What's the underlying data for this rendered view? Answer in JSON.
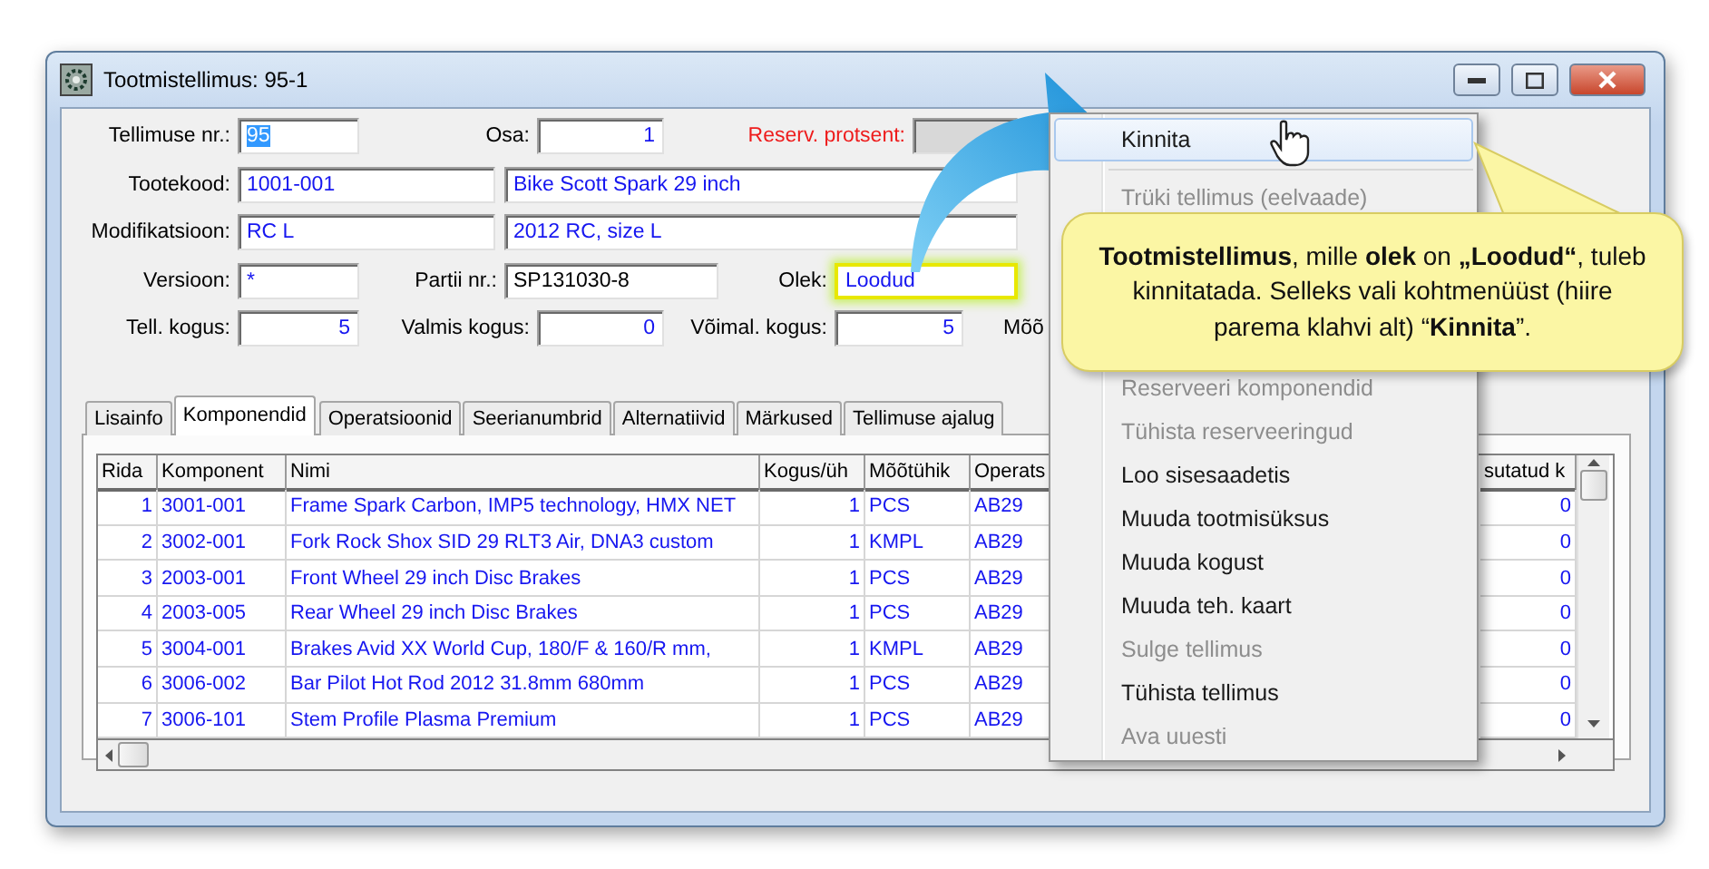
{
  "window": {
    "title": "Tootmistellimus: 95-1"
  },
  "form": {
    "rows": [
      {
        "cells": [
          {
            "kind": "label",
            "text": "Tellimuse nr.:",
            "alert": false
          },
          {
            "kind": "text-field",
            "value": "95",
            "selected": true,
            "disabled": false,
            "highlighted": false
          },
          {
            "kind": "label",
            "text": "Osa:",
            "alert": false
          },
          {
            "kind": "number-field",
            "value": "1",
            "selected": false,
            "disabled": false,
            "highlighted": false
          },
          {
            "kind": "label",
            "text": "Reserv. protsent:",
            "alert": true
          },
          {
            "kind": "text-field",
            "disabled": true,
            "highlighted": false
          }
        ]
      },
      {
        "cells": [
          {
            "kind": "label",
            "text": "Tootekood:",
            "alert": false
          },
          {
            "kind": "text-field",
            "value": "1001-001",
            "selected": false,
            "disabled": false,
            "highlighted": false
          },
          {
            "kind": "text-field",
            "value": "Bike Scott Spark 29 inch",
            "selected": false,
            "disabled": false,
            "highlighted": false
          }
        ]
      },
      {
        "cells": [
          {
            "kind": "label",
            "text": "Modifikatsioon:",
            "alert": false
          },
          {
            "kind": "text-field",
            "value": "RC L",
            "selected": false,
            "disabled": false,
            "highlighted": false
          },
          {
            "kind": "text-field",
            "value": "2012 RC, size L",
            "selected": false,
            "disabled": false,
            "highlighted": false
          }
        ]
      },
      {
        "cells": [
          {
            "kind": "label",
            "text": "Versioon:",
            "alert": false
          },
          {
            "kind": "text-field",
            "value": "*",
            "selected": false,
            "disabled": false,
            "highlighted": false
          },
          {
            "kind": "label",
            "text": "Partii nr.:",
            "alert": false
          },
          {
            "kind": "plain-field",
            "value": "SP131030-8",
            "selected": false,
            "disabled": false,
            "highlighted": false
          },
          {
            "kind": "label",
            "text": "Olek:",
            "alert": false
          },
          {
            "kind": "text-field",
            "value": "Loodud",
            "selected": false,
            "disabled": false,
            "highlighted": true
          }
        ]
      },
      {
        "cells": [
          {
            "kind": "label",
            "text": "Tell. kogus:",
            "alert": false
          },
          {
            "kind": "number-field",
            "value": "5",
            "selected": false,
            "disabled": false,
            "highlighted": false
          },
          {
            "kind": "label",
            "text": "Valmis kogus:",
            "alert": false
          },
          {
            "kind": "number-field",
            "value": "0",
            "selected": false,
            "disabled": false,
            "highlighted": false
          },
          {
            "kind": "label",
            "text": "Võimal. kogus:",
            "alert": false
          },
          {
            "kind": "number-field",
            "value": "5",
            "selected": false,
            "disabled": false,
            "highlighted": false
          },
          {
            "kind": "label",
            "text": "Mõõ",
            "alert": false
          }
        ]
      }
    ]
  },
  "tabs": [
    {
      "label": "Lisainfo",
      "selected": false
    },
    {
      "label": "Komponendid",
      "selected": true
    },
    {
      "label": "Operatsioonid",
      "selected": false
    },
    {
      "label": "Seerianumbrid",
      "selected": false
    },
    {
      "label": "Alternatiivid",
      "selected": false
    },
    {
      "label": "Märkused",
      "selected": false
    },
    {
      "label": "Tellimuse ajalug",
      "selected": false
    }
  ],
  "table": {
    "columns": [
      "Rida",
      "Komponent",
      "Nimi",
      "Kogus/üh",
      "Mõõtühik",
      "Operats",
      "sutatud k"
    ],
    "rows": [
      [
        "1",
        "3001-001",
        "Frame Spark Carbon, IMP5 technology, HMX NET",
        "1",
        "PCS",
        "AB29",
        "0"
      ],
      [
        "2",
        "3002-001",
        "Fork Rock Shox SID 29 RLT3 Air, DNA3 custom",
        "1",
        "KMPL",
        "AB29",
        "0"
      ],
      [
        "3",
        "2003-001",
        "Front Wheel 29 inch Disc Brakes",
        "1",
        "PCS",
        "AB29",
        "0"
      ],
      [
        "4",
        "2003-005",
        "Rear Wheel 29 inch Disc Brakes",
        "1",
        "PCS",
        "AB29",
        "0"
      ],
      [
        "5",
        "3004-001",
        "Brakes Avid XX World Cup, 180/F & 160/R mm,",
        "1",
        "KMPL",
        "AB29",
        "0"
      ],
      [
        "6",
        "3006-002",
        "Bar Pilot Hot Rod 2012 31.8mm 680mm",
        "1",
        "PCS",
        "AB29",
        "0"
      ],
      [
        "7",
        "3006-101",
        "Stem Profile Plasma Premium",
        "1",
        "PCS",
        "AB29",
        "0"
      ]
    ]
  },
  "context_menu": {
    "items": [
      {
        "kind": "item",
        "label": "Kinnita",
        "selected": true,
        "disabled": false
      },
      {
        "kind": "separator"
      },
      {
        "kind": "item",
        "label": "Trüki tellimus (eelvaade)",
        "selected": false,
        "disabled": true
      },
      {
        "kind": "item",
        "label": "Reserveeri komponendid",
        "selected": false,
        "disabled": true
      },
      {
        "kind": "item",
        "label": "Tühista reserveeringud",
        "selected": false,
        "disabled": true
      },
      {
        "kind": "item",
        "label": "Loo sisesaadetis",
        "selected": false,
        "disabled": false
      },
      {
        "kind": "item",
        "label": "Muuda tootmisüksus",
        "selected": false,
        "disabled": false
      },
      {
        "kind": "item",
        "label": "Muuda kogust",
        "selected": false,
        "disabled": false
      },
      {
        "kind": "item",
        "label": "Muuda teh. kaart",
        "selected": false,
        "disabled": false
      },
      {
        "kind": "item",
        "label": "Sulge tellimus",
        "selected": false,
        "disabled": true
      },
      {
        "kind": "item",
        "label": "Tühista tellimus",
        "selected": false,
        "disabled": false
      },
      {
        "kind": "item",
        "label": "Ava uuesti",
        "selected": false,
        "disabled": true
      }
    ]
  },
  "callout": {
    "text": "**Tootmistellimus**, mille **olek** on **„Loodud“**, tuleb kinnitatada. Selleks vali kohtmenüüst (hiire parema klahvi alt) “**Kinnita**”."
  }
}
